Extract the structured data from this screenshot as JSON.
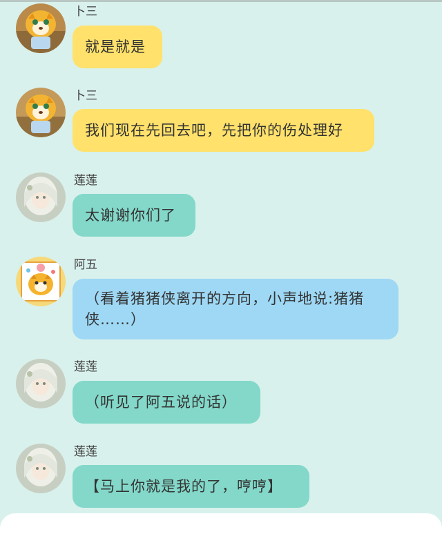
{
  "messages": [
    {
      "speaker": "卜三",
      "avatar": "tiger-avatar",
      "color": "#ffe16b",
      "text": "就是就是"
    },
    {
      "speaker": "卜三",
      "avatar": "tiger-avatar",
      "color": "#ffe16b",
      "text": "我们现在先回去吧，先把你的伤处理好"
    },
    {
      "speaker": "莲莲",
      "avatar": "girl-avatar",
      "color": "#83d8c9",
      "text": "太谢谢你们了"
    },
    {
      "speaker": "阿五",
      "avatar": "tiger-cartoon-avatar",
      "color": "#9ed8f5",
      "text_line1": "（看着猪猪侠离开的方向，小声地说:猪猪",
      "text_line2": "侠……）"
    },
    {
      "speaker": "莲莲",
      "avatar": "girl-avatar",
      "color": "#83d8c9",
      "text": "（听见了阿五说的话）"
    },
    {
      "speaker": "莲莲",
      "avatar": "girl-avatar",
      "color": "#83d8c9",
      "text": "【马上你就是我的了，哼哼】"
    }
  ]
}
